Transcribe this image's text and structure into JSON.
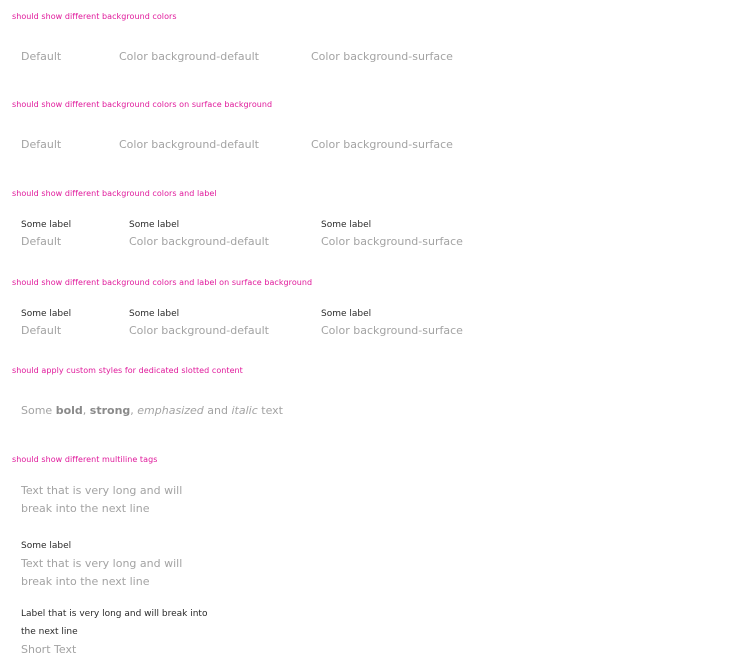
{
  "sections": {
    "bg_colors": {
      "heading": "should show different background colors",
      "tags": {
        "default": "Default",
        "bg_default": "Color background-default",
        "bg_surface": "Color background-surface"
      }
    },
    "bg_colors_surface": {
      "heading": "should show different background colors on surface background",
      "tags": {
        "default": "Default",
        "bg_default": "Color background-default",
        "bg_surface": "Color background-surface"
      }
    },
    "bg_colors_label": {
      "heading": "should show different background colors and label",
      "tags": {
        "default": {
          "label": "Some label",
          "text": "Default"
        },
        "bg_default": {
          "label": "Some label",
          "text": "Color background-default"
        },
        "bg_surface": {
          "label": "Some label",
          "text": "Color background-surface"
        }
      }
    },
    "bg_colors_label_surface": {
      "heading": "should show different background colors and label on surface background",
      "tags": {
        "default": {
          "label": "Some label",
          "text": "Default"
        },
        "bg_default": {
          "label": "Some label",
          "text": "Color background-default"
        },
        "bg_surface": {
          "label": "Some label",
          "text": "Color background-surface"
        }
      }
    },
    "slotted": {
      "heading": "should apply custom styles for dedicated slotted content",
      "parts": {
        "some": "Some ",
        "bold": "bold",
        "comma1": ", ",
        "strong": "strong",
        "comma2": ", ",
        "emphasized": "emphasized",
        "and": " and ",
        "italic": "italic",
        "text": " text"
      }
    },
    "multiline": {
      "heading": "should show different multiline tags",
      "tags": {
        "long_text": "Text that is very long and will break into the next line",
        "labeled": {
          "label": "Some label",
          "text": "Text that is very long and will break into the next line"
        },
        "long_label": {
          "label": "Label that is very long and will break into the next line",
          "text": "Short Text"
        }
      }
    }
  },
  "colors": {
    "heading": "#e0199b",
    "tag_text": "#a3a3a3",
    "label_text": "#2a2a2a"
  }
}
